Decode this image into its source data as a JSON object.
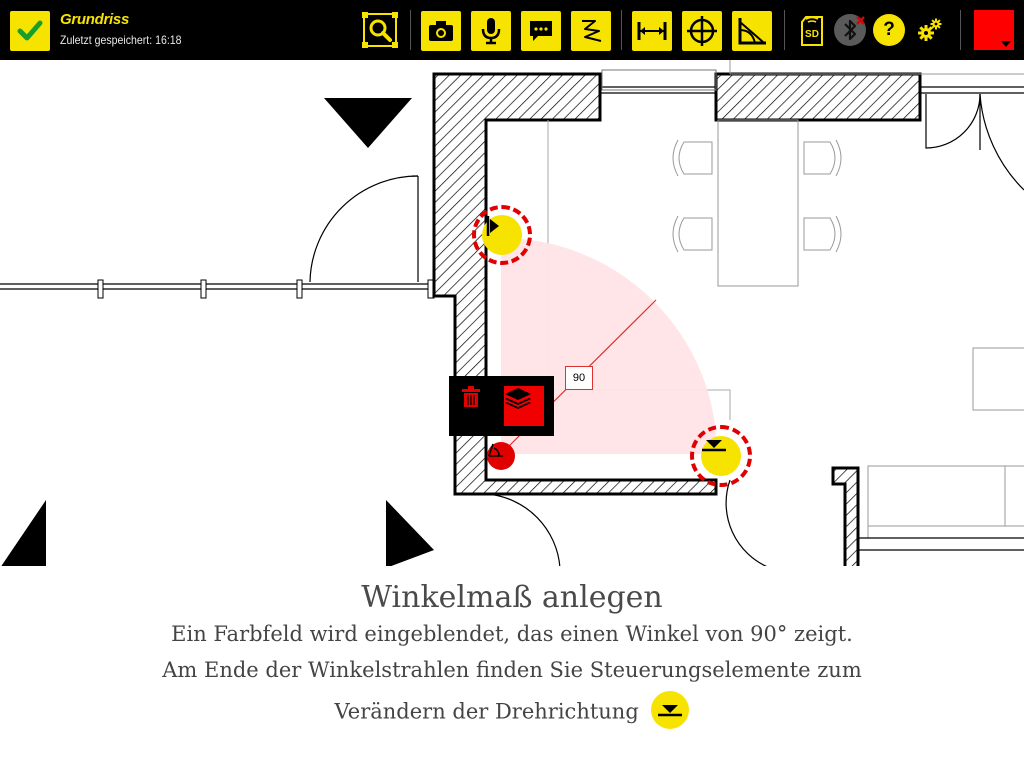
{
  "toolbar": {
    "title": "Grundriss",
    "saved_label": "Zuletzt gespeichert: 16:18",
    "icons": {
      "confirm": "checkmark-icon",
      "zoom": "zoom-fit-icon",
      "camera": "camera-icon",
      "microphone": "microphone-icon",
      "comment": "comment-icon",
      "freehand": "freehand-line-icon",
      "distance": "distance-measure-icon",
      "crosshair": "crosshair-icon",
      "angle": "angle-measure-icon",
      "sd_card": "sd-card-icon",
      "bluetooth": "bluetooth-disconnected-icon",
      "help": "help-icon",
      "settings": "settings-icon",
      "color": "color-swatch"
    },
    "sd_label": "SD",
    "help_label": "?",
    "active_color": "#ff0000",
    "accent_color": "#f7e300"
  },
  "canvas": {
    "angle_value": "90",
    "context_menu": {
      "delete": "trash-icon",
      "layers": "layers-icon"
    },
    "controls": {
      "ray_start": "rotation-handle-icon",
      "ray_end": "rotation-handle-icon",
      "angle_origin": "angle-origin-icon"
    },
    "colors": {
      "sector_fill": "#ffe4e6",
      "ray_line": "#e03030",
      "highlight_ring": "#e00000"
    }
  },
  "caption": {
    "title": "Winkelmaß anlegen",
    "line1": "Ein Farbfeld wird eingeblendet, das einen Winkel von 90° zeigt.",
    "line2": "Am Ende der Winkelstrahlen finden Sie Steuerungselemente zum",
    "line3": "Verändern der Drehrichtung",
    "icon": "rotation-handle-icon"
  }
}
